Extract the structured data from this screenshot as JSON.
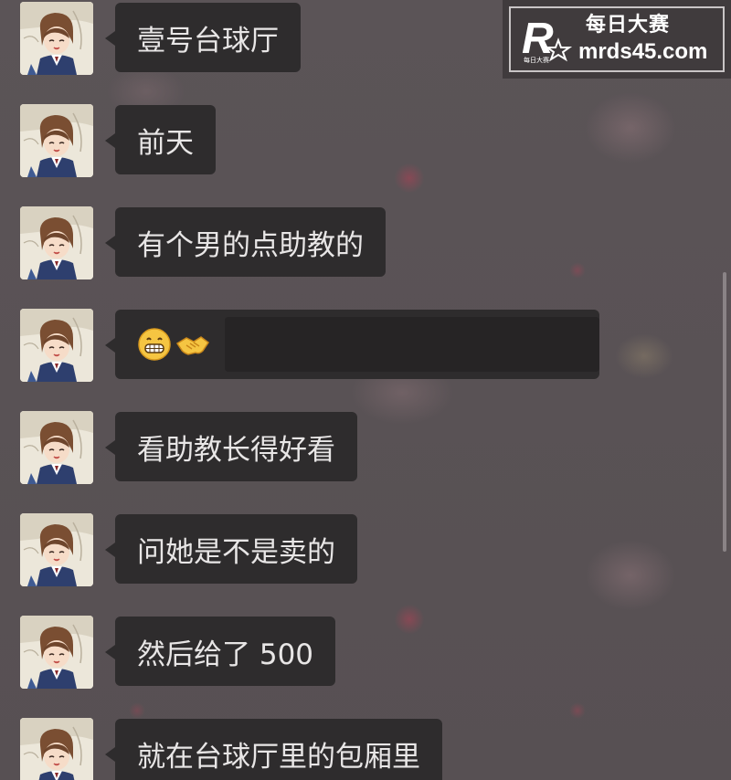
{
  "watermark": {
    "brand": "每日大赛",
    "url": "mrds45.com",
    "logo_text": "每日大赛"
  },
  "messages": [
    {
      "text": "壹号台球厅",
      "avatar_icon": "anime-girl-avatar"
    },
    {
      "text": "前天",
      "avatar_icon": "anime-girl-avatar"
    },
    {
      "text": "有个男的点助教的",
      "avatar_icon": "anime-girl-avatar"
    },
    {
      "text": "",
      "emoji": [
        "grinning-face-emoji",
        "handshake-emoji"
      ],
      "avatar_icon": "anime-girl-avatar"
    },
    {
      "text": "看助教长得好看",
      "avatar_icon": "anime-girl-avatar"
    },
    {
      "text": "问她是不是卖的",
      "avatar_icon": "anime-girl-avatar"
    },
    {
      "text": "然后给了 500",
      "avatar_icon": "anime-girl-avatar"
    },
    {
      "text": "就在台球厅里的包厢里",
      "avatar_icon": "anime-girl-avatar"
    }
  ],
  "colors": {
    "bubble": "#2e2c2d",
    "bubble_text": "#e8e6e6",
    "background": "#5a5255",
    "watermark_bg": "#403b3d"
  }
}
